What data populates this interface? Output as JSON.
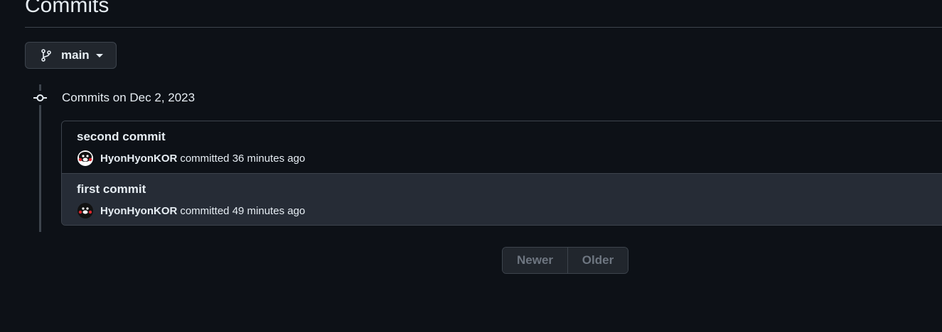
{
  "page": {
    "title": "Commits"
  },
  "branch_selector": {
    "label": "main",
    "icon": "git-branch-icon"
  },
  "commit_group": {
    "heading": "Commits on Dec 2, 2023",
    "commits": [
      {
        "title": "second commit",
        "author": "HyonHyonKOR",
        "meta": "committed 36 minutes ago"
      },
      {
        "title": "first commit",
        "author": "HyonHyonKOR",
        "meta": "committed 49 minutes ago"
      }
    ]
  },
  "pagination": {
    "newer_label": "Newer",
    "older_label": "Older"
  },
  "colors": {
    "background": "#0d1117",
    "border": "#3d444d",
    "text": "#e6edf3",
    "disabled_text": "#6e7681"
  }
}
